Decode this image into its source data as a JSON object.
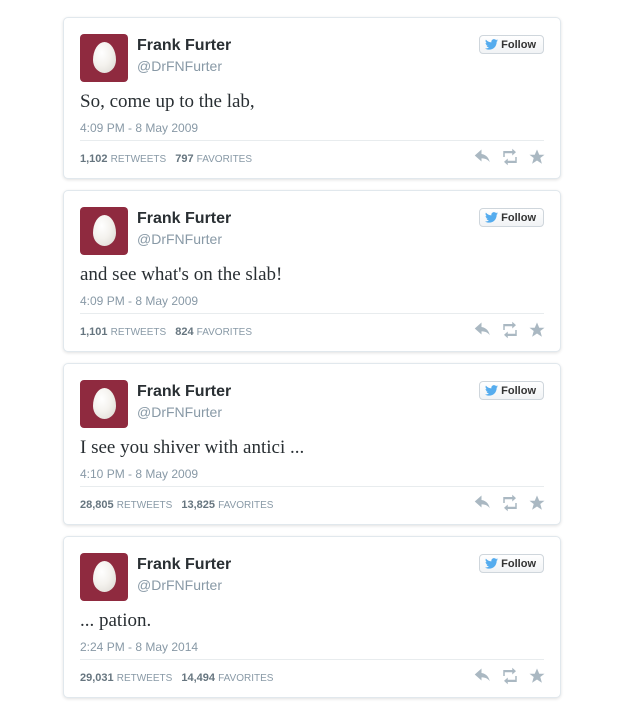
{
  "colors": {
    "avatar_bg": "#8f2a3f",
    "twitter_blue": "#55acee",
    "action_gray": "#aab8c2",
    "meta_gray": "#8899a6"
  },
  "tweets": [
    {
      "name": "Frank Furter",
      "handle": "@DrFNFurter",
      "follow_label": "Follow",
      "text": "So, come up to the lab,",
      "timestamp": "4:09 PM - 8 May 2009",
      "retweets": "1,102",
      "retweets_label": "RETWEETS",
      "favorites": "797",
      "favorites_label": "FAVORITES"
    },
    {
      "name": "Frank Furter",
      "handle": "@DrFNFurter",
      "follow_label": "Follow",
      "text": "and see what's on the slab!",
      "timestamp": "4:09 PM - 8 May 2009",
      "retweets": "1,101",
      "retweets_label": "RETWEETS",
      "favorites": "824",
      "favorites_label": "FAVORITES"
    },
    {
      "name": "Frank Furter",
      "handle": "@DrFNFurter",
      "follow_label": "Follow",
      "text": "I see you shiver with antici ...",
      "timestamp": "4:10 PM - 8 May 2009",
      "retweets": "28,805",
      "retweets_label": "RETWEETS",
      "favorites": "13,825",
      "favorites_label": "FAVORITES"
    },
    {
      "name": "Frank Furter",
      "handle": "@DrFNFurter",
      "follow_label": "Follow",
      "text": "... pation.",
      "timestamp": "2:24 PM - 8 May 2014",
      "retweets": "29,031",
      "retweets_label": "RETWEETS",
      "favorites": "14,494",
      "favorites_label": "FAVORITES"
    }
  ],
  "icons": {
    "avatar": "egg-avatar-icon",
    "follow": "twitter-bird-icon",
    "reply": "reply-icon",
    "retweet": "retweet-icon",
    "favorite": "star-icon"
  }
}
